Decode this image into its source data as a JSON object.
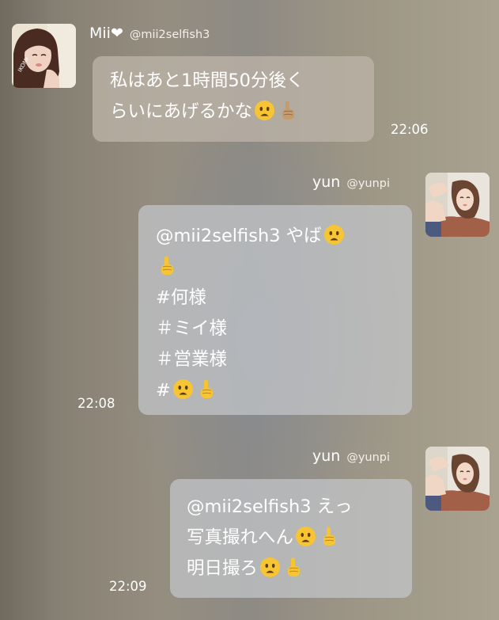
{
  "messages": [
    {
      "sender_name": "Mii❤",
      "sender_handle": "@mii2selfish3",
      "lines": [
        "私はあと1時間50分後く",
        "らいにあげるかな"
      ],
      "line_emojis": [
        [],
        [
          "frowning-face-icon",
          "pointing-up-icon"
        ]
      ],
      "time": "22:06"
    },
    {
      "sender_name": "yun",
      "sender_handle": "@yunpi",
      "lines": [
        "@mii2selfish3 やば",
        "",
        "#何様",
        "＃ミイ様",
        "＃営業様",
        "#"
      ],
      "line_emojis": [
        [
          "frowning-face-icon"
        ],
        [
          "pointing-up-icon"
        ],
        [],
        [],
        [],
        [
          "frowning-face-icon",
          "pointing-up-icon"
        ]
      ],
      "time": "22:08"
    },
    {
      "sender_name": "yun",
      "sender_handle": "@yunpi",
      "lines": [
        "@mii2selfish3 えっ",
        "写真撮れへん",
        "明日撮ろ"
      ],
      "line_emojis": [
        [],
        [
          "frowning-face-icon",
          "pointing-up-icon"
        ],
        [
          "frowning-face-icon",
          "pointing-up-icon"
        ]
      ],
      "time": "22:09"
    }
  ],
  "colors": {
    "incoming_bubble": "#bcb4a8",
    "outgoing_bubble": "#c4c6cb",
    "text": "#ffffff",
    "emoji_face": "#f7c533",
    "skin_tone_hand": "#c69c6d"
  }
}
